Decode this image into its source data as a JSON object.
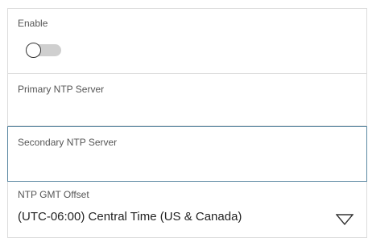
{
  "enable": {
    "label": "Enable",
    "state": "off"
  },
  "primary_ntp": {
    "label": "Primary NTP Server",
    "value": ""
  },
  "secondary_ntp": {
    "label": "Secondary NTP Server",
    "value": ""
  },
  "gmt_offset": {
    "label": "NTP GMT Offset",
    "selected": "(UTC-06:00) Central Time (US & Canada)",
    "icon": "triangle-down-icon"
  },
  "colors": {
    "focus_border": "#5c89a3",
    "field_border": "#dcdcdc",
    "toggle_track_off": "#cfcfcf"
  }
}
